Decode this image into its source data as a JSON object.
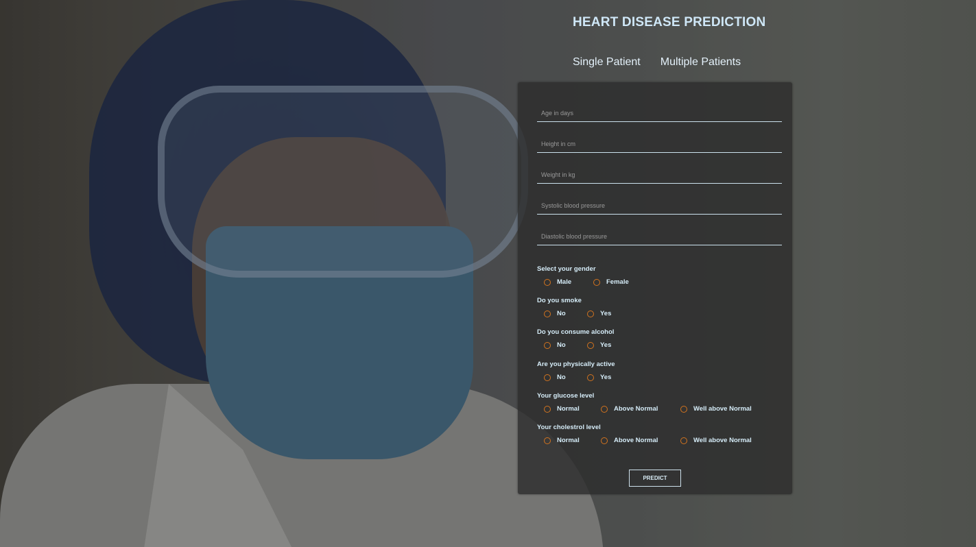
{
  "header": {
    "title": "HEART DISEASE PREDICTION"
  },
  "tabs": [
    {
      "label": "Single Patient"
    },
    {
      "label": "Multiple Patients"
    }
  ],
  "form": {
    "fields": [
      {
        "placeholder": "Age in days",
        "value": ""
      },
      {
        "placeholder": "Height in cm",
        "value": ""
      },
      {
        "placeholder": "Weight in kg",
        "value": ""
      },
      {
        "placeholder": "Systolic blood pressure",
        "value": ""
      },
      {
        "placeholder": "Diastolic blood pressure",
        "value": ""
      }
    ],
    "questions": [
      {
        "label": "Select your gender",
        "options": [
          "Male",
          "Female"
        ]
      },
      {
        "label": "Do you smoke",
        "options": [
          "No",
          "Yes"
        ]
      },
      {
        "label": "Do you consume alcohol",
        "options": [
          "No",
          "Yes"
        ]
      },
      {
        "label": "Are you physically active",
        "options": [
          "No",
          "Yes"
        ]
      },
      {
        "label": "Your glucose level",
        "options": [
          "Normal",
          "Above Normal",
          "Well above Normal"
        ]
      },
      {
        "label": "Your cholestrol level",
        "options": [
          "Normal",
          "Above Normal",
          "Well above Normal"
        ]
      }
    ],
    "submit_label": "PREDICT"
  },
  "colors": {
    "title": "#cfe7f7",
    "panel_bg": "#2d2d2d",
    "radio_accent": "#d3741f",
    "text": "#d6edf9"
  }
}
